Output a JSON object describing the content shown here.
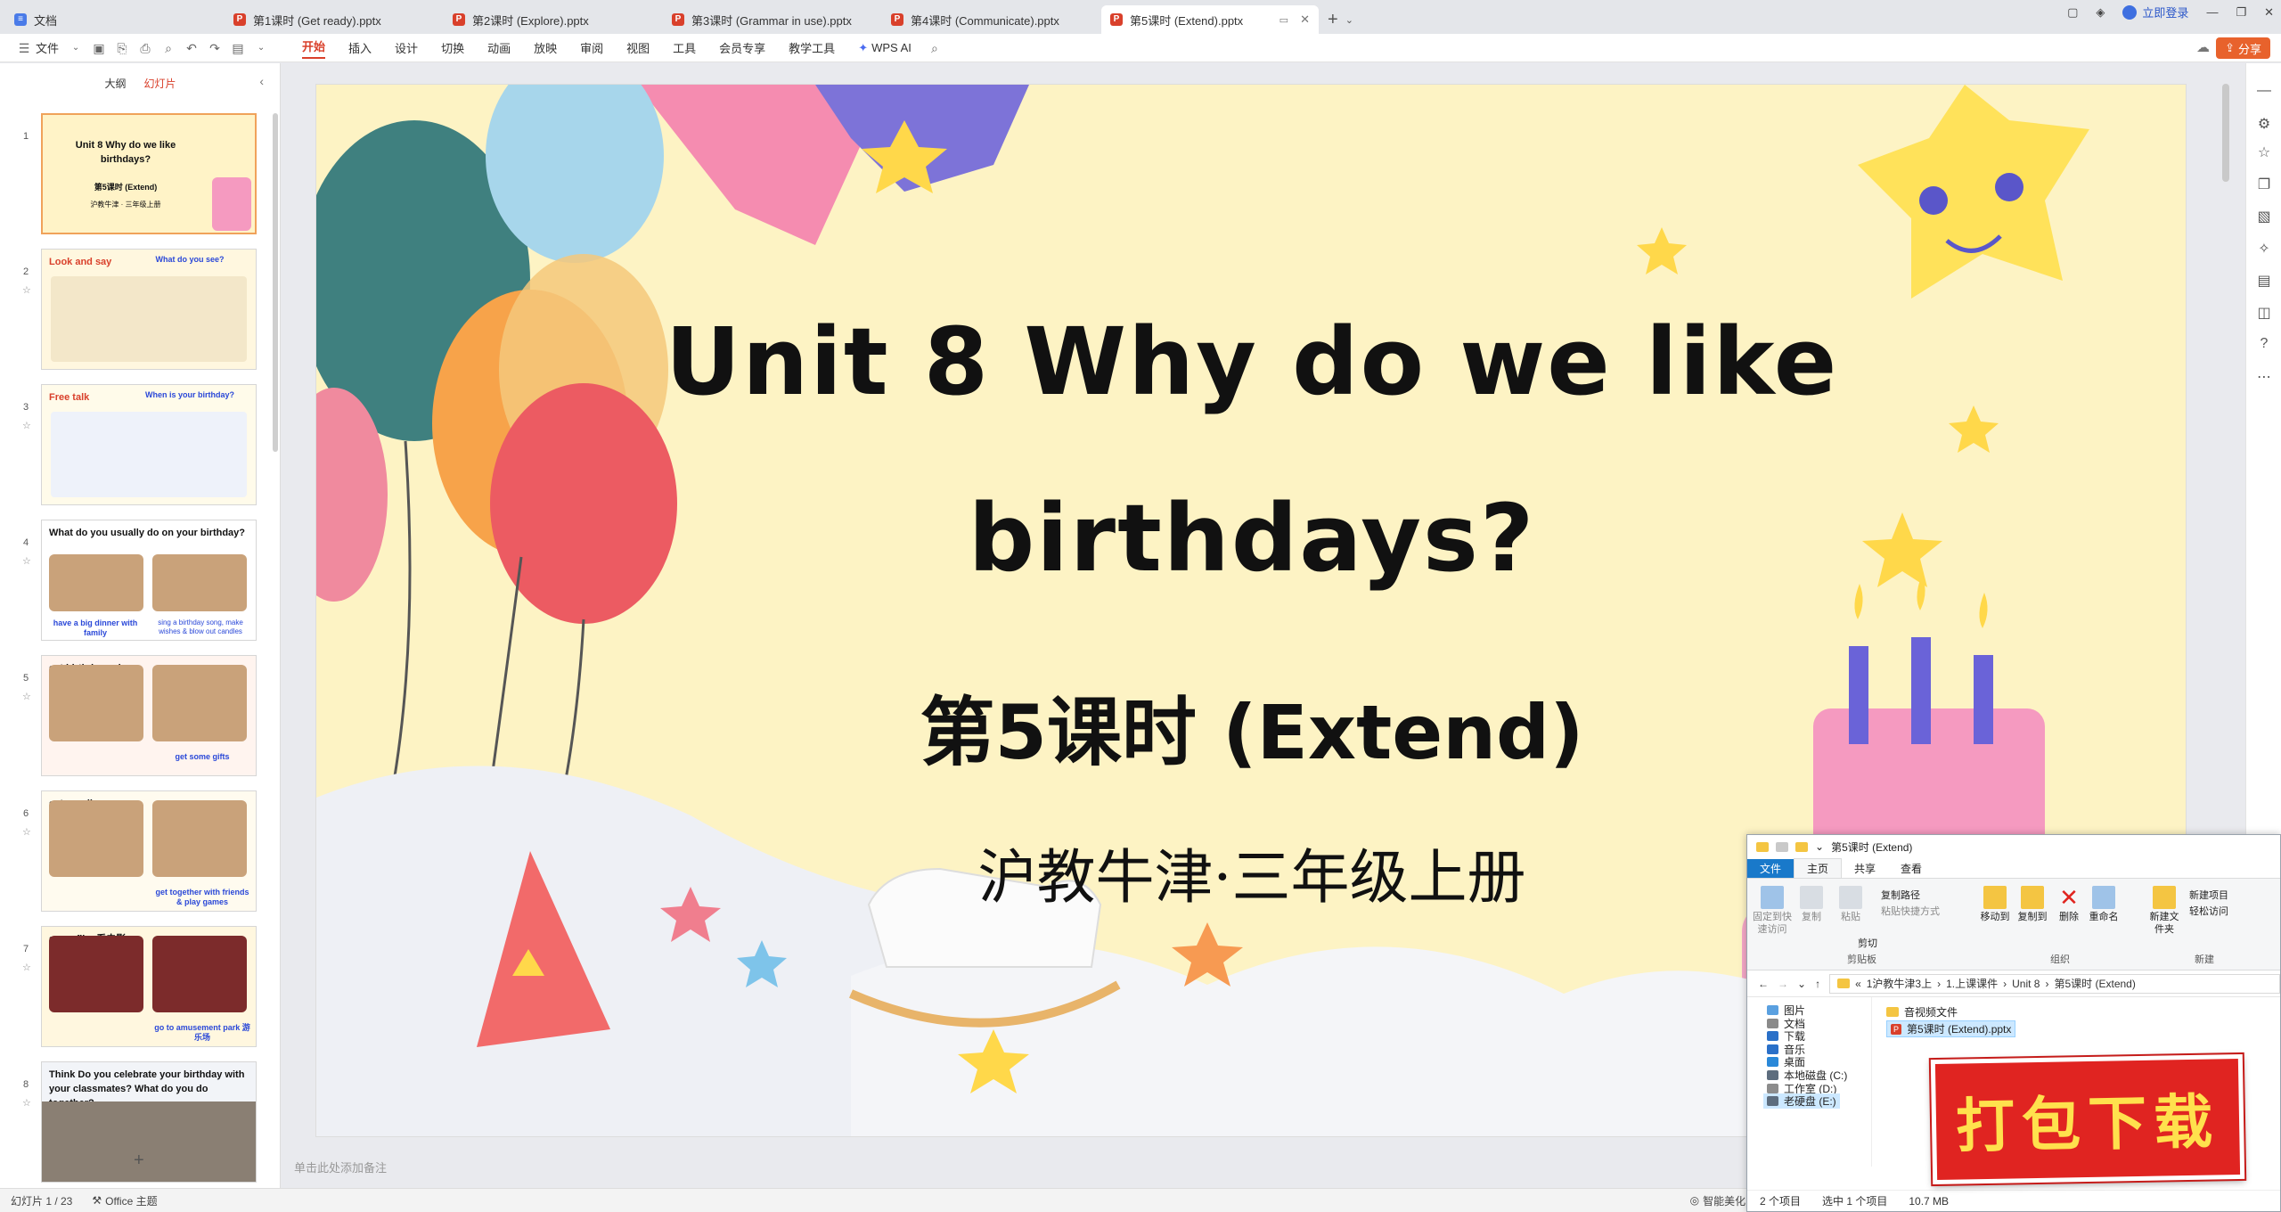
{
  "tabs": [
    {
      "label": "文档",
      "icon": "doc-icon",
      "active": false
    },
    {
      "label": "第1课时 (Get ready).pptx",
      "icon": "ppt-icon",
      "active": false
    },
    {
      "label": "第2课时 (Explore).pptx",
      "icon": "ppt-icon",
      "active": false
    },
    {
      "label": "第3课时 (Grammar in use).pptx",
      "icon": "ppt-icon",
      "active": false
    },
    {
      "label": "第4课时 (Communicate).pptx",
      "icon": "ppt-icon",
      "active": false
    },
    {
      "label": "第5课时 (Extend).pptx",
      "icon": "ppt-icon",
      "active": true
    }
  ],
  "login_label": "立即登录",
  "ribbon": {
    "file_label": "文件",
    "menus": [
      "开始",
      "插入",
      "设计",
      "切换",
      "动画",
      "放映",
      "审阅",
      "视图",
      "工具",
      "会员专享",
      "教学工具"
    ],
    "wps_ai": "WPS AI",
    "share": "分享"
  },
  "left_panel": {
    "tabs": [
      "大纲",
      "幻灯片"
    ],
    "active_tab": "幻灯片",
    "thumbnails": [
      {
        "num": "1",
        "title": "Unit 8 Why do we like birthdays?",
        "sub": "第5课时 (Extend)",
        "sub2": "沪教牛津 · 三年级上册"
      },
      {
        "num": "2",
        "title": "Look and say",
        "sub": "What do you see?"
      },
      {
        "num": "3",
        "title": "Free talk",
        "sub": "When is your birthday?"
      },
      {
        "num": "4",
        "title": "What do you usually do on your birthday?",
        "sub": "have a big dinner with family",
        "sub2": "sing a birthday song, make wishes & blow out candles"
      },
      {
        "num": "5",
        "title": "eat birthday cake",
        "sub": "get some gifts"
      },
      {
        "num": "6",
        "title": "eat noodles",
        "sub": "get together with friends & play games"
      },
      {
        "num": "7",
        "title": "see a film 看电影",
        "sub": "go to amusement park 游乐场"
      },
      {
        "num": "8",
        "title": "Think Do you celebrate your birthday with your classmates? What do you do together?"
      }
    ]
  },
  "slide": {
    "title_line1": "Unit 8 Why do we like",
    "title_line2": "birthdays?",
    "lesson": "第5课时 (Extend)",
    "publisher": "沪教牛津·三年级上册"
  },
  "notes_placeholder": "单击此处添加备注",
  "status": {
    "slide": "幻灯片 1 / 23",
    "theme": "Office 主题",
    "smart": "智能美化"
  },
  "explorer": {
    "title": "第5课时 (Extend)",
    "menus": [
      "文件",
      "主页",
      "共享",
      "查看"
    ],
    "ribbon_buttons": [
      "固定到快速访问",
      "复制",
      "粘贴",
      "移动到",
      "复制到",
      "删除",
      "重命名",
      "新建文件夹"
    ],
    "ribbon_small": [
      "复制路径",
      "粘贴快捷方式",
      "剪切",
      "新建项目",
      "轻松访问"
    ],
    "groups": [
      "剪贴板",
      "组织",
      "新建"
    ],
    "path": [
      "1沪教牛津3上",
      "1.上课课件",
      "Unit 8",
      "第5课时 (Extend)"
    ],
    "nav": [
      "图片",
      "文档",
      "下载",
      "音乐",
      "桌面",
      "本地磁盘 (C:)",
      "工作室 (D:)",
      "老硬盘 (E:)"
    ],
    "files": [
      "音视频文件",
      "第5课时 (Extend).pptx"
    ],
    "status_count": "2 个项目",
    "status_sel": "选中 1 个项目",
    "status_size": "10.7 MB"
  },
  "stamp": "打包下载",
  "colors": {
    "accent": "#d9402b",
    "share": "#e8622c",
    "slide_bg": "#fdf3c4",
    "stamp": "#e02421"
  }
}
